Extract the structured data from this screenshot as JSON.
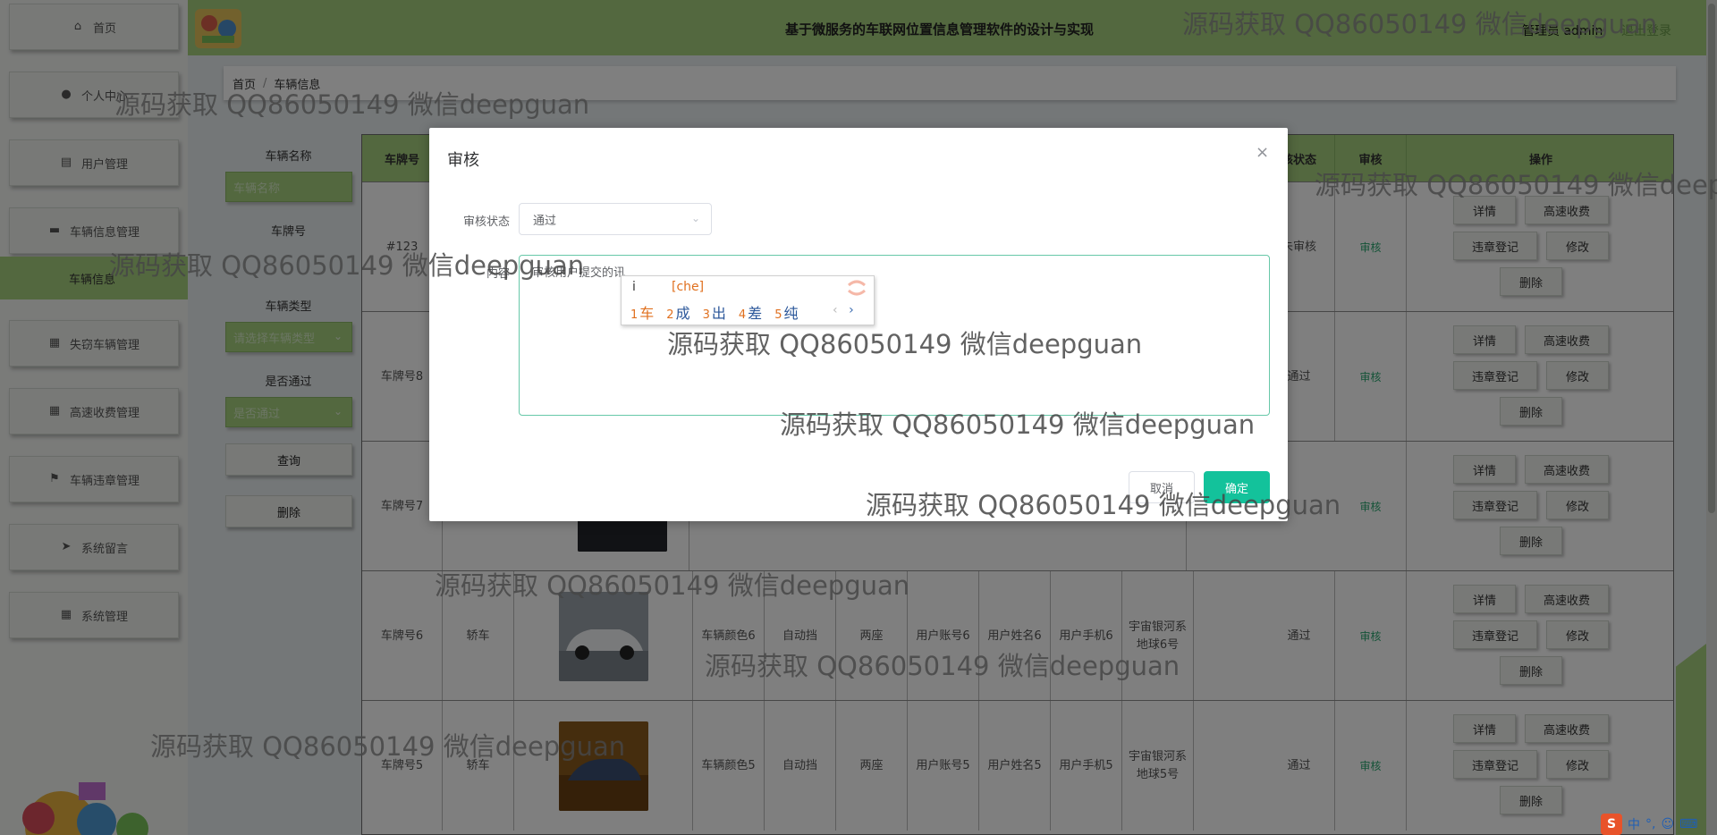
{
  "sidebar": {
    "items": [
      {
        "label": "首页",
        "icon": "home-icon"
      },
      {
        "label": "个人中心",
        "icon": "user-icon"
      },
      {
        "label": "用户管理",
        "icon": "briefcase-icon"
      },
      {
        "label": "车辆信息管理",
        "icon": "card-icon"
      },
      {
        "label": "失窃车辆管理",
        "icon": "grid-icon"
      },
      {
        "label": "高速收费管理",
        "icon": "grid-icon"
      },
      {
        "label": "车辆违章管理",
        "icon": "flag-icon"
      },
      {
        "label": "系统留言",
        "icon": "send-icon"
      },
      {
        "label": "系统管理",
        "icon": "grid-icon"
      }
    ],
    "active_item": "车辆信息"
  },
  "header": {
    "title": "基于微服务的车联网位置信息管理软件的设计与实现",
    "user": "管理员 admin",
    "logout": "退出登录"
  },
  "breadcrumb": {
    "home": "首页",
    "separator": "/",
    "current": "车辆信息"
  },
  "search": {
    "name_label": "车辆名称",
    "name_placeholder": "车辆名称",
    "plate_label": "车牌号",
    "type_label": "车辆类型",
    "type_placeholder": "请选择车辆类型",
    "passed_label": "是否通过",
    "passed_placeholder": "是否通过",
    "query_button": "查询",
    "delete_button": "删除"
  },
  "table": {
    "headers": [
      "车牌号",
      "核状态",
      "审核",
      "操作"
    ],
    "rows": [
      {
        "plate": "#123",
        "status": "未审核",
        "review": "审核"
      },
      {
        "plate": "车牌号8",
        "status": "通过",
        "review": "审核"
      },
      {
        "plate": "车牌号7",
        "status": "",
        "review": "审核"
      },
      {
        "plate": "车牌号6",
        "type": "轿车",
        "color": "车辆颜色6",
        "gear": "自动挡",
        "seats": "两座",
        "account": "用户账号6",
        "name": "用户姓名6",
        "phone": "用户手机6",
        "address": "宇宙银河系地球6号",
        "status": "通过",
        "review": "审核"
      },
      {
        "plate": "车牌号5",
        "type": "轿车",
        "color": "车辆颜色5",
        "gear": "自动挡",
        "seats": "两座",
        "account": "用户账号5",
        "name": "用户姓名5",
        "phone": "用户手机5",
        "address": "宇宙银河系地球5号",
        "status": "通过",
        "review": "审核"
      }
    ],
    "row3_address_tail": "号",
    "actions": {
      "detail": "详情",
      "toll": "高速收费",
      "violation": "违章登记",
      "edit": "修改",
      "delete": "删除"
    }
  },
  "dialog": {
    "title": "审核",
    "close": "×",
    "status_label": "审核状态",
    "status_value": "通过",
    "content_label": "内容",
    "content_value": "审核用户提交的讯",
    "cancel": "取消",
    "confirm": "确定"
  },
  "ime": {
    "composition": "i",
    "pinyin": "[che]",
    "candidates": [
      {
        "n": "1",
        "c": "车"
      },
      {
        "n": "2",
        "c": "成"
      },
      {
        "n": "3",
        "c": "出"
      },
      {
        "n": "4",
        "c": "差"
      },
      {
        "n": "5",
        "c": "纯"
      }
    ],
    "prev": "‹",
    "next": "›"
  },
  "watermark": "源码获取 QQ86050149 微信deepguan",
  "watermark_cut_1": "源码获取 QQ86050149 微信deep",
  "watermark_cut_2": "源码获取 QQ86050149 微信deepguan",
  "tray": {
    "ime_s": "S",
    "lang": "中",
    "punct": "°,"
  },
  "colors": {
    "accent_green": "#a7d07f",
    "confirm_teal": "#13c29b",
    "link_green": "#2aa771"
  }
}
